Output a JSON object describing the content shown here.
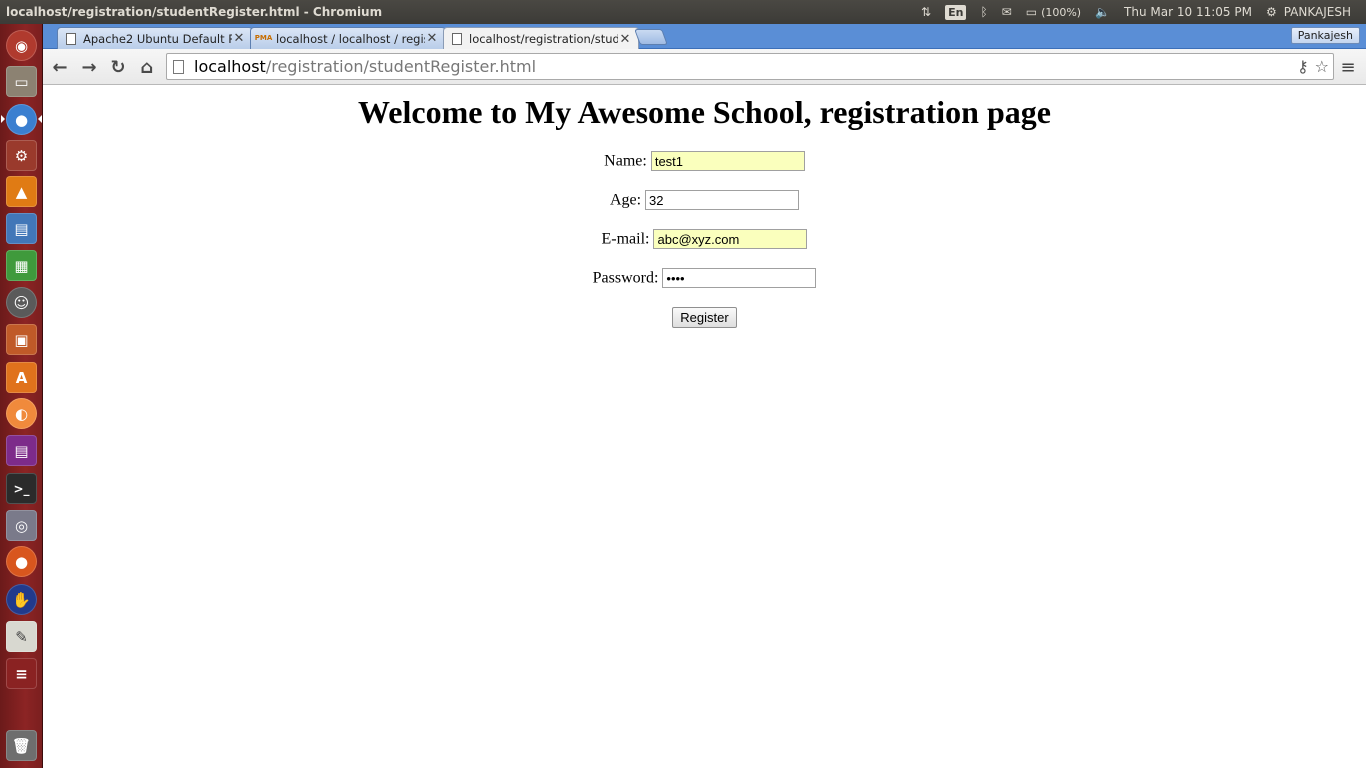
{
  "window": {
    "title": "localhost/registration/studentRegister.html - Chromium"
  },
  "panel": {
    "lang": "En",
    "battery": "(100%)",
    "datetime": "Thu Mar 10 11:05 PM",
    "user": "PANKAJESH"
  },
  "tabs": [
    {
      "title": "Apache2 Ubuntu Default Pa",
      "icon": "page-icon"
    },
    {
      "title": "localhost / localhost / regist",
      "icon": "pma-icon",
      "icon_text": "PMA"
    },
    {
      "title": "localhost/registration/studer",
      "icon": "page-icon"
    }
  ],
  "profile": {
    "label": "Pankajesh"
  },
  "omnibox": {
    "host": "localhost",
    "path": "/registration/studentRegister.html"
  },
  "form": {
    "heading": "Welcome to My Awesome School, registration page",
    "name_label": "Name:",
    "name_value": "test1",
    "age_label": "Age:",
    "age_value": "32",
    "email_label": "E-mail:",
    "email_value": "abc@xyz.com",
    "password_label": "Password:",
    "password_value": "••••",
    "register_label": "Register"
  },
  "colors": {
    "autofill": "#faffbd",
    "launcher": "#8c2424",
    "tabstrip": "#5a8ed6"
  }
}
